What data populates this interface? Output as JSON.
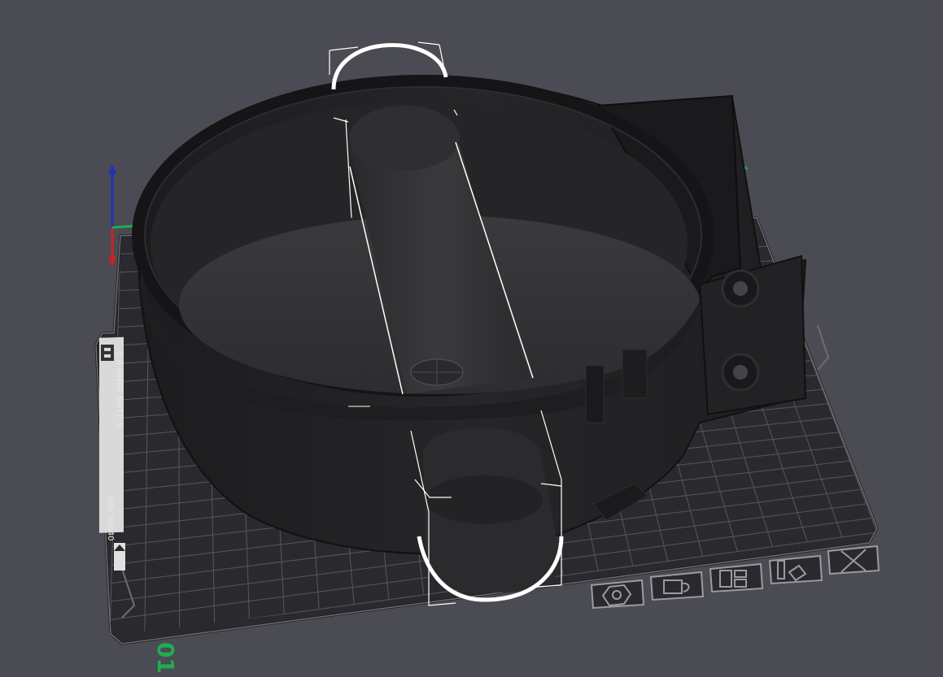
{
  "viewport": {
    "background": "#4b4b53",
    "plate_color": "#2b2b2f",
    "grid_color": "#55555b",
    "model_color": "#232325",
    "selection_color": "#ffffff"
  },
  "bed": {
    "id_label": "01",
    "id_color": "#1fae4e",
    "sticker_icon": "printer-brand-icon",
    "sticker_line1": "3.0 HHRF SHTF 5",
    "sticker_line2": "S/N: S0040"
  },
  "axes": {
    "x_color": "#d02020",
    "y_color": "#1fae4e",
    "z_color": "#2030c0"
  },
  "bed_icons": [
    {
      "name": "nut-icon"
    },
    {
      "name": "material-icon"
    },
    {
      "name": "layout-icon"
    },
    {
      "name": "shapes-icon"
    },
    {
      "name": "close-icon"
    }
  ]
}
